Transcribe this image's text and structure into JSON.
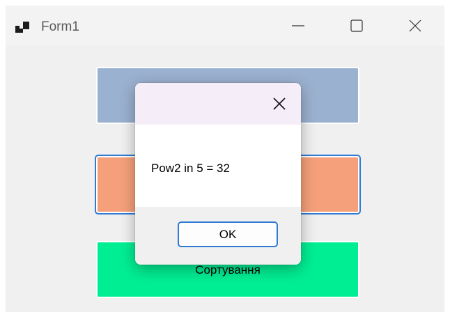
{
  "window": {
    "title": "Form1",
    "icon": "app-window-icon",
    "controls": {
      "minimize_icon": "minimize-icon",
      "maximize_icon": "maximize-icon",
      "close_icon": "close-icon"
    }
  },
  "form": {
    "buttons": [
      {
        "label": "",
        "color": "#9bb1d0"
      },
      {
        "label": "",
        "color": "#f6a07b"
      },
      {
        "label": "Сортування",
        "color": "#00ee93"
      }
    ]
  },
  "dialog": {
    "message": "Pow2 in 5 = 32",
    "ok_label": "OK",
    "close_icon": "close-icon"
  },
  "colors": {
    "accent": "#2f7bd4",
    "dialog_header": "#f5eef8"
  }
}
